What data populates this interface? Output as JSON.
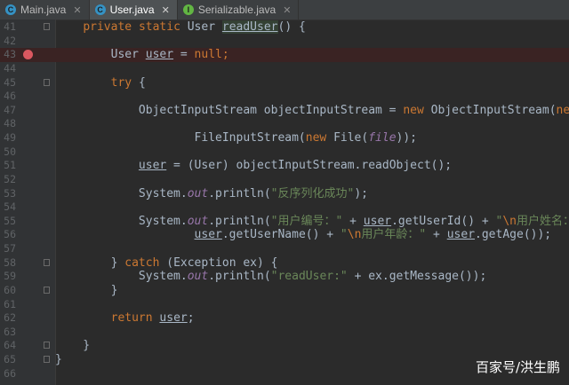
{
  "tabs": [
    {
      "name": "Main.java",
      "icon": "C",
      "icon_color": "#3592c4",
      "active": false
    },
    {
      "name": "User.java",
      "icon": "C",
      "icon_color": "#3592c4",
      "active": true
    },
    {
      "name": "Serializable.java",
      "icon": "I",
      "icon_color": "#62b543",
      "active": false
    }
  ],
  "colors": {
    "keyword": "#cc7832",
    "string": "#6a8759",
    "field": "#9876aa",
    "plain": "#a9b7c6",
    "breakpoint": "#db5860"
  },
  "lines": [
    {
      "n": "41",
      "segs": [
        [
          "    "
        ],
        [
          "private ",
          "kw"
        ],
        [
          "static ",
          "kw"
        ],
        [
          "User "
        ],
        [
          "readUser",
          "und hl"
        ],
        [
          "() {"
        ]
      ]
    },
    {
      "n": "42",
      "segs": []
    },
    {
      "n": "43",
      "bp": true,
      "segs": [
        [
          "        User "
        ],
        [
          "user",
          "und"
        ],
        [
          " = "
        ],
        [
          "null",
          "kw"
        ],
        [
          ";",
          "kw"
        ]
      ]
    },
    {
      "n": "44",
      "segs": []
    },
    {
      "n": "45",
      "segs": [
        [
          "        "
        ],
        [
          "try ",
          "kw"
        ],
        [
          "{"
        ]
      ]
    },
    {
      "n": "46",
      "segs": []
    },
    {
      "n": "47",
      "segs": [
        [
          "            ObjectInputStream objectInputStream = "
        ],
        [
          "new ",
          "kw"
        ],
        [
          "ObjectInputStream("
        ],
        [
          "new",
          "kw"
        ]
      ]
    },
    {
      "n": "48",
      "segs": []
    },
    {
      "n": "49",
      "segs": [
        [
          "                    FileInputStream("
        ],
        [
          "new ",
          "kw"
        ],
        [
          "File("
        ],
        [
          "file",
          "fld"
        ],
        [
          "));"
        ]
      ]
    },
    {
      "n": "50",
      "segs": []
    },
    {
      "n": "51",
      "segs": [
        [
          "            "
        ],
        [
          "user",
          "und"
        ],
        [
          " = (User) objectInputStream.readObject();"
        ]
      ]
    },
    {
      "n": "52",
      "segs": []
    },
    {
      "n": "53",
      "segs": [
        [
          "            System."
        ],
        [
          "out",
          "fld"
        ],
        [
          ".println("
        ],
        [
          "\"反序列化成功\"",
          "str"
        ],
        [
          ");"
        ]
      ]
    },
    {
      "n": "54",
      "segs": []
    },
    {
      "n": "55",
      "segs": [
        [
          "            System."
        ],
        [
          "out",
          "fld"
        ],
        [
          ".println("
        ],
        [
          "\"用户编号：\"",
          "str"
        ],
        [
          " + "
        ],
        [
          "user",
          "und"
        ],
        [
          ".getUserId() + "
        ],
        [
          "\"",
          "str"
        ],
        [
          "\\n",
          "esc"
        ],
        [
          "用户姓名：\"",
          "str"
        ],
        [
          " +"
        ]
      ]
    },
    {
      "n": "56",
      "segs": [
        [
          "                    "
        ],
        [
          "user",
          "und"
        ],
        [
          ".getUserName() + "
        ],
        [
          "\"",
          "str"
        ],
        [
          "\\n",
          "esc"
        ],
        [
          "用户年龄：\"",
          "str"
        ],
        [
          " + "
        ],
        [
          "user",
          "und"
        ],
        [
          ".getAge());"
        ]
      ]
    },
    {
      "n": "57",
      "segs": []
    },
    {
      "n": "58",
      "segs": [
        [
          "        } "
        ],
        [
          "catch ",
          "kw"
        ],
        [
          "(Exception ex) {"
        ]
      ]
    },
    {
      "n": "59",
      "segs": [
        [
          "            System."
        ],
        [
          "out",
          "fld"
        ],
        [
          ".println("
        ],
        [
          "\"readUser:\"",
          "str"
        ],
        [
          " + ex.getMessage());"
        ]
      ]
    },
    {
      "n": "60",
      "segs": [
        [
          "        }"
        ]
      ]
    },
    {
      "n": "61",
      "segs": []
    },
    {
      "n": "62",
      "segs": [
        [
          "        "
        ],
        [
          "return ",
          "kw"
        ],
        [
          "user",
          "und"
        ],
        [
          ";"
        ]
      ]
    },
    {
      "n": "63",
      "segs": []
    },
    {
      "n": "64",
      "segs": [
        [
          "    }"
        ]
      ]
    },
    {
      "n": "65",
      "segs": [
        [
          "}"
        ]
      ]
    },
    {
      "n": "66",
      "segs": []
    }
  ],
  "watermark": "百家号/洪生鹏"
}
